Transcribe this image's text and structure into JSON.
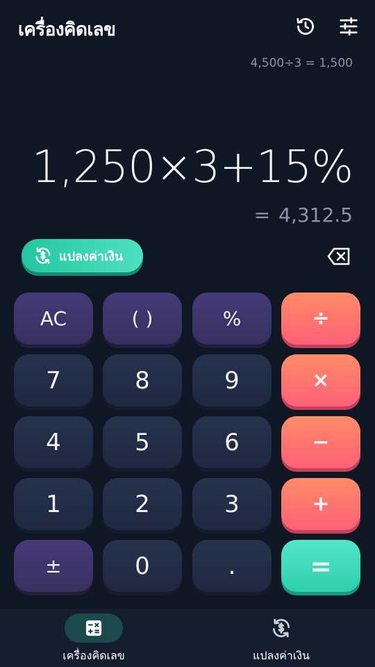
{
  "header": {
    "title": "เครื่องคิดเลข",
    "history_icon": "history-icon",
    "settings_icon": "sliders-icon"
  },
  "display": {
    "history": "4,500÷3 = 1,500",
    "expression": "1,250×3+15%",
    "result_eq": "=",
    "result": "4,312.5"
  },
  "convert_button": {
    "label": "แปลงค่าเงิน",
    "icon": "currency-exchange-icon"
  },
  "backspace_icon": "backspace-icon",
  "keys": {
    "ac": "AC",
    "parens": "( )",
    "percent": "%",
    "divide": "÷",
    "seven": "7",
    "eight": "8",
    "nine": "9",
    "multiply": "×",
    "four": "4",
    "five": "5",
    "six": "6",
    "minus": "−",
    "one": "1",
    "two": "2",
    "three": "3",
    "plus": "+",
    "sign": "±",
    "zero": "0",
    "decimal": ".",
    "equals": "="
  },
  "bottom_nav": {
    "calculator": {
      "label": "เครื่องคิดเลข",
      "icon": "calculator-icon",
      "active": true
    },
    "converter": {
      "label": "แปลงค่าเงิน",
      "icon": "currency-exchange-icon",
      "active": false
    }
  },
  "colors": {
    "background": "#0f1624",
    "number_key": "#222c46",
    "function_key": "#3f3570",
    "operator_key": "#ff7470",
    "accent_teal": "#34d3b1"
  }
}
